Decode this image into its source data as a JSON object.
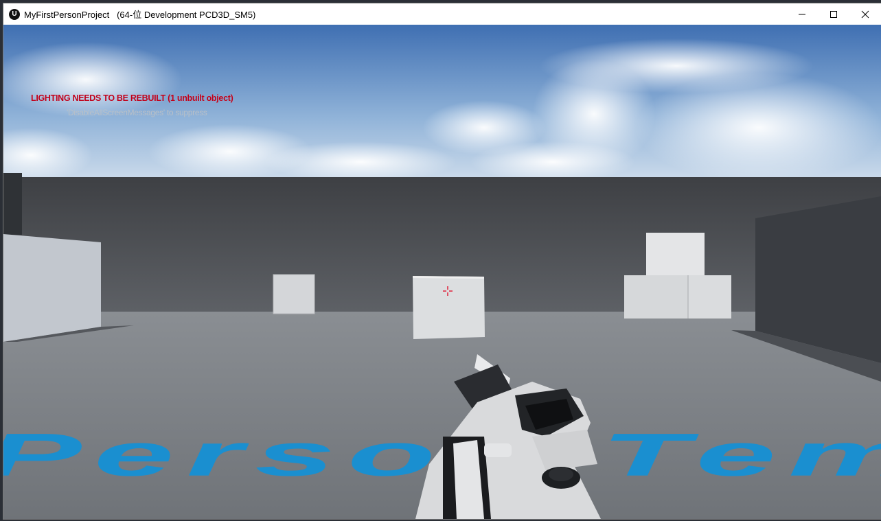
{
  "window": {
    "app_icon_glyph": "U",
    "title": "MyFirstPersonProject   (64-位 Development PCD3D_SM5)",
    "controls": [
      "minimize-icon",
      "maximize-icon",
      "close-icon"
    ]
  },
  "viewport": {
    "messages": {
      "warning": "LIGHTING NEEDS TO BE REBUILT (1 unbuilt object)",
      "hint": "'DisableAllScreenMessages' to suppress"
    },
    "floor_text": "First Person Template",
    "crosshair_icon": "crosshair-icon",
    "colors": {
      "warning": "#c0001a",
      "floor_text": "#1a8fd0",
      "crosshair": "#e0203a"
    }
  }
}
